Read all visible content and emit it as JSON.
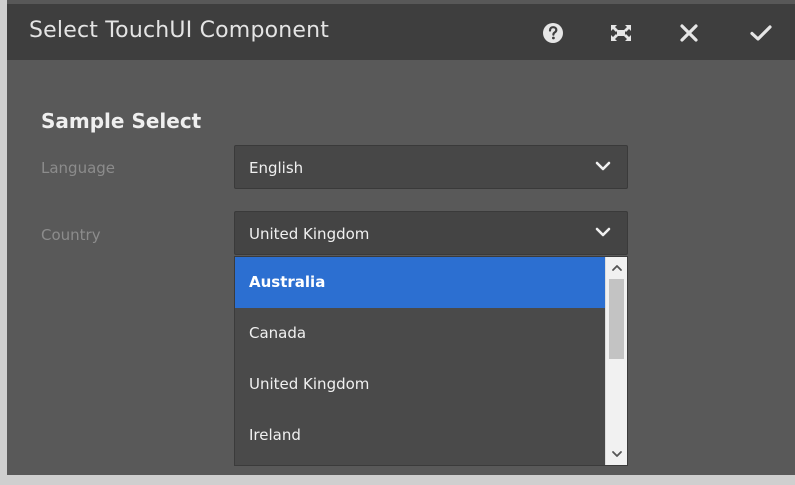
{
  "dialog": {
    "title": "Select TouchUI Component",
    "icons": {
      "help": "help-circle-icon",
      "fullscreen": "fullscreen-icon",
      "close": "close-x-icon",
      "done": "checkmark-icon"
    }
  },
  "form": {
    "heading": "Sample Select",
    "language": {
      "label": "Language",
      "value": "English"
    },
    "country": {
      "label": "Country",
      "value": "United Kingdom",
      "open": true,
      "options": [
        "Australia",
        "Canada",
        "United Kingdom",
        "Ireland"
      ],
      "highlighted_option": "Australia"
    }
  },
  "colors": {
    "titlebar": "#3e3e3e",
    "dialog_background": "#595959",
    "highlight": "#2c6fd1"
  }
}
